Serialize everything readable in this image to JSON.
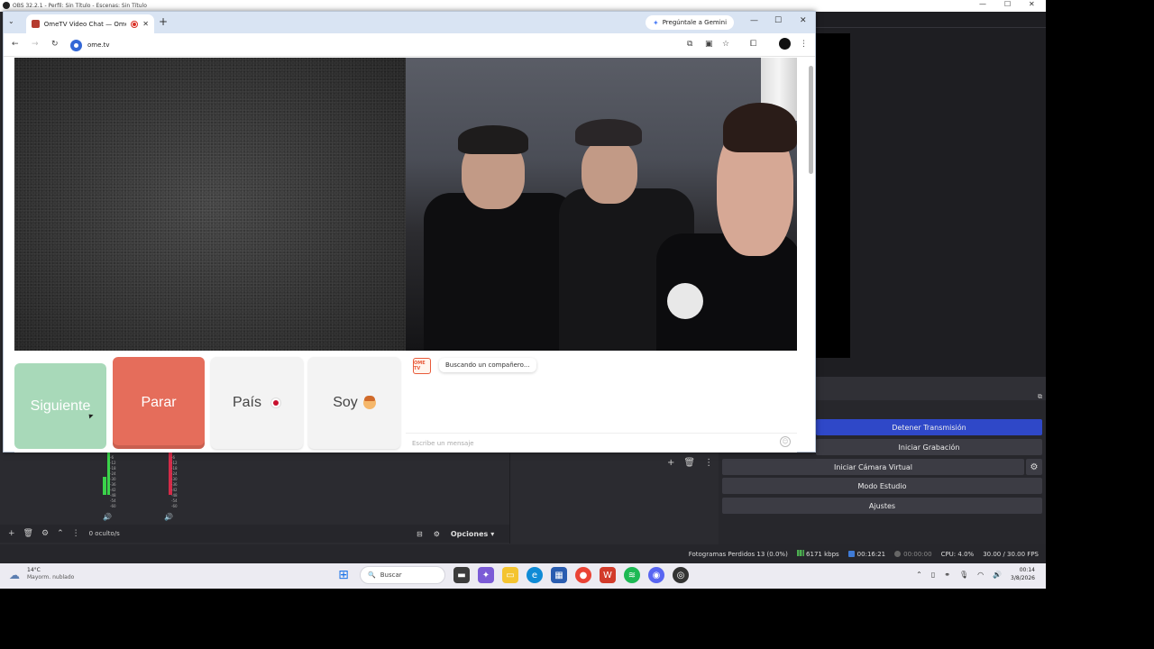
{
  "obs": {
    "title": "OBS 32.2.1 - Perfil: Sin Título - Escenas: Sin Título",
    "controls": {
      "stop_stream": "Detener Transmisión",
      "start_recording": "Iniciar Grabación",
      "start_virtual_cam": "Iniciar Cámara Virtual",
      "studio_mode": "Modo Estudio",
      "settings": "Ajustes"
    },
    "mixer": {
      "hidden_count": "0 oculto/s",
      "options_label": "Opciones",
      "meter_ticks": [
        "-6",
        "-12",
        "-18",
        "-24",
        "-30",
        "-36",
        "-42",
        "-48",
        "-54",
        "-60"
      ]
    },
    "status": {
      "dropped_frames": "Fotogramas Perdidos 13 (0.0%)",
      "bitrate": "6171 kbps",
      "stream_time": "00:16:21",
      "record_time": "00:00:00",
      "cpu": "CPU: 4.0%",
      "fps": "30.00 / 30.00 FPS"
    }
  },
  "browser": {
    "tab_title": "OmeTV Video Chat — Ome",
    "gemini_label": "Pregúntale a Gemini",
    "url": "ome.tv"
  },
  "ometv": {
    "btn_next": "Siguiente",
    "btn_stop": "Parar",
    "btn_country": "País",
    "btn_gender": "Soy",
    "logo_text": "OME TV",
    "status_bubble": "Buscando un compañero...",
    "message_placeholder": "Escribe un mensaje"
  },
  "taskbar": {
    "temperature": "14°C",
    "weather_desc": "Mayorm. nublado",
    "search_label": "Buscar",
    "time": "00:14",
    "date": "3/8/2026"
  },
  "colors": {
    "stop_button": "#e56d5b",
    "next_button": "#a8d9b9",
    "obs_accent": "#2f48c8"
  }
}
